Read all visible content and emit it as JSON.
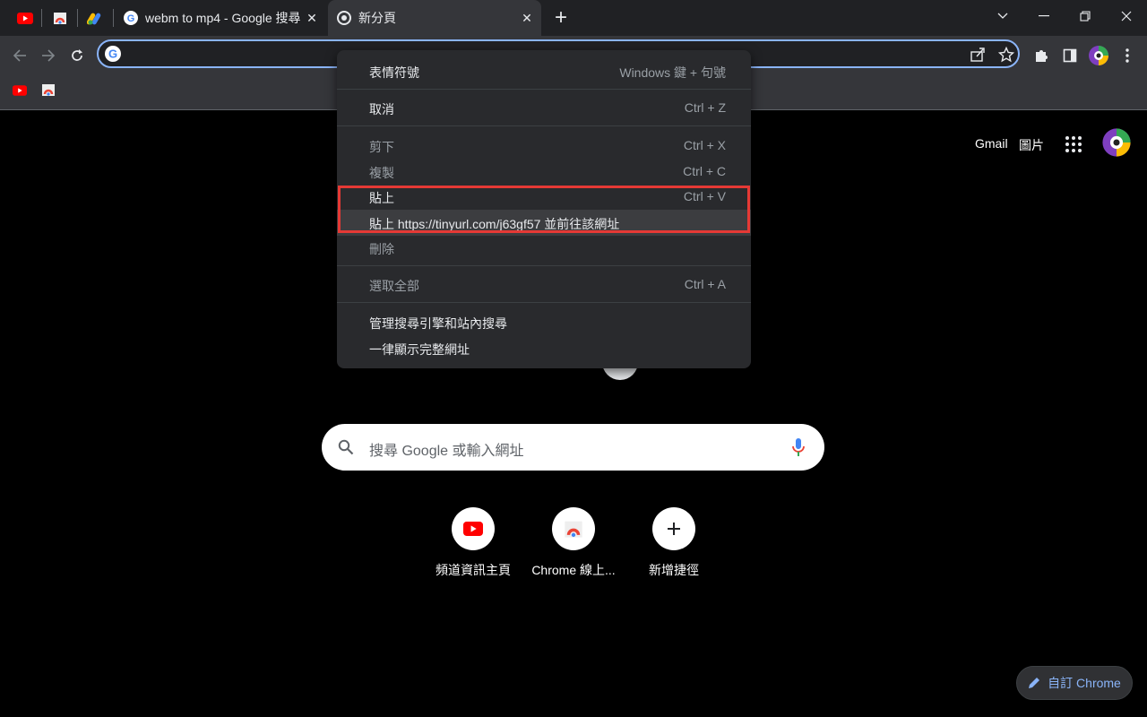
{
  "tabs": [
    {
      "title": "webm to mp4 - Google 搜尋",
      "active": false
    },
    {
      "title": "新分頁",
      "active": true
    }
  ],
  "new_tab_symbol": "+",
  "close_symbol": "✕",
  "ntp": {
    "links": [
      "Gmail",
      "圖片"
    ],
    "search_placeholder": "搜尋 Google 或輸入網址",
    "shortcuts": [
      {
        "label": "頻道資訊主頁",
        "icon": "youtube-icon"
      },
      {
        "label": "Chrome 線上...",
        "icon": "chrome-store-icon"
      },
      {
        "label": "新增捷徑",
        "icon": "plus-icon"
      }
    ],
    "customize_label": "自訂 Chrome"
  },
  "context_menu": {
    "items": [
      {
        "label": "表情符號",
        "shortcut": "Windows 鍵 + 句號",
        "disabled": false
      },
      {
        "label": "取消",
        "shortcut": "Ctrl + Z",
        "disabled": false
      },
      {
        "label": "剪下",
        "shortcut": "Ctrl + X",
        "disabled": true
      },
      {
        "label": "複製",
        "shortcut": "Ctrl + C",
        "disabled": true
      },
      {
        "label": "貼上",
        "shortcut": "Ctrl + V",
        "disabled": false
      },
      {
        "label": "貼上 https://tinyurl.com/j63gf57 並前往該網址",
        "shortcut": "",
        "disabled": false
      },
      {
        "label": "刪除",
        "shortcut": "",
        "disabled": true
      },
      {
        "label": "選取全部",
        "shortcut": "Ctrl + A",
        "disabled": true
      },
      {
        "label": "管理搜尋引擎和站內搜尋",
        "shortcut": "",
        "disabled": false
      },
      {
        "label": "一律顯示完整網址",
        "shortcut": "",
        "disabled": false
      }
    ]
  },
  "colors": {
    "accent": "#8ab4f8",
    "highlight_box": "#e53935"
  }
}
